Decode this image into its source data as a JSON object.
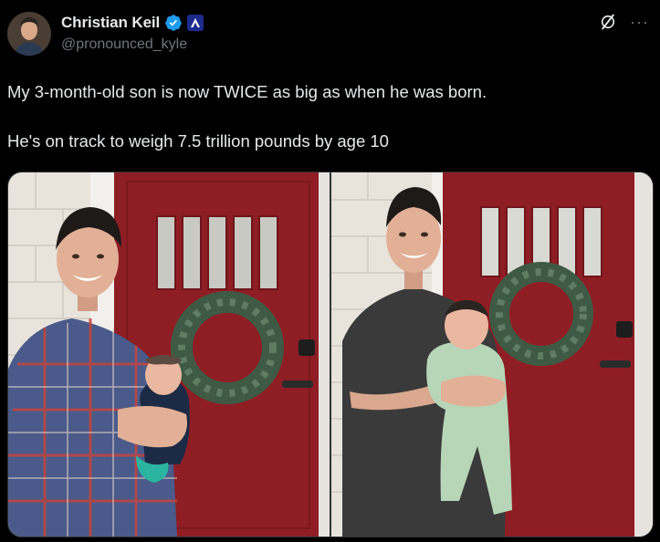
{
  "author": {
    "display_name": "Christian Keil",
    "handle": "@pronounced_kyle",
    "verified": true,
    "affiliate_badge": "affiliate-badge-icon",
    "avatar_icon": "avatar-portrait"
  },
  "header_actions": {
    "grok_icon": "grok-icon",
    "more_icon": "more-icon",
    "more_glyph": "···"
  },
  "tweet": {
    "paragraphs": [
      "My 3-month-old son is now TWICE as big as when he was born.",
      "He's on track to weigh 7.5 trillion pounds by age 10"
    ]
  },
  "media": {
    "count": 2,
    "photos": [
      {
        "subject": "man in plaid shirt holding newborn in front of red door with wreath"
      },
      {
        "subject": "man in grey t-shirt holding 3-month-old baby in front of red door with wreath"
      }
    ]
  },
  "colors": {
    "background": "#000000",
    "text": "#e7e9ea",
    "secondary": "#71767b",
    "verified": "#1d9bf0",
    "door_red": "#8e1e24"
  }
}
